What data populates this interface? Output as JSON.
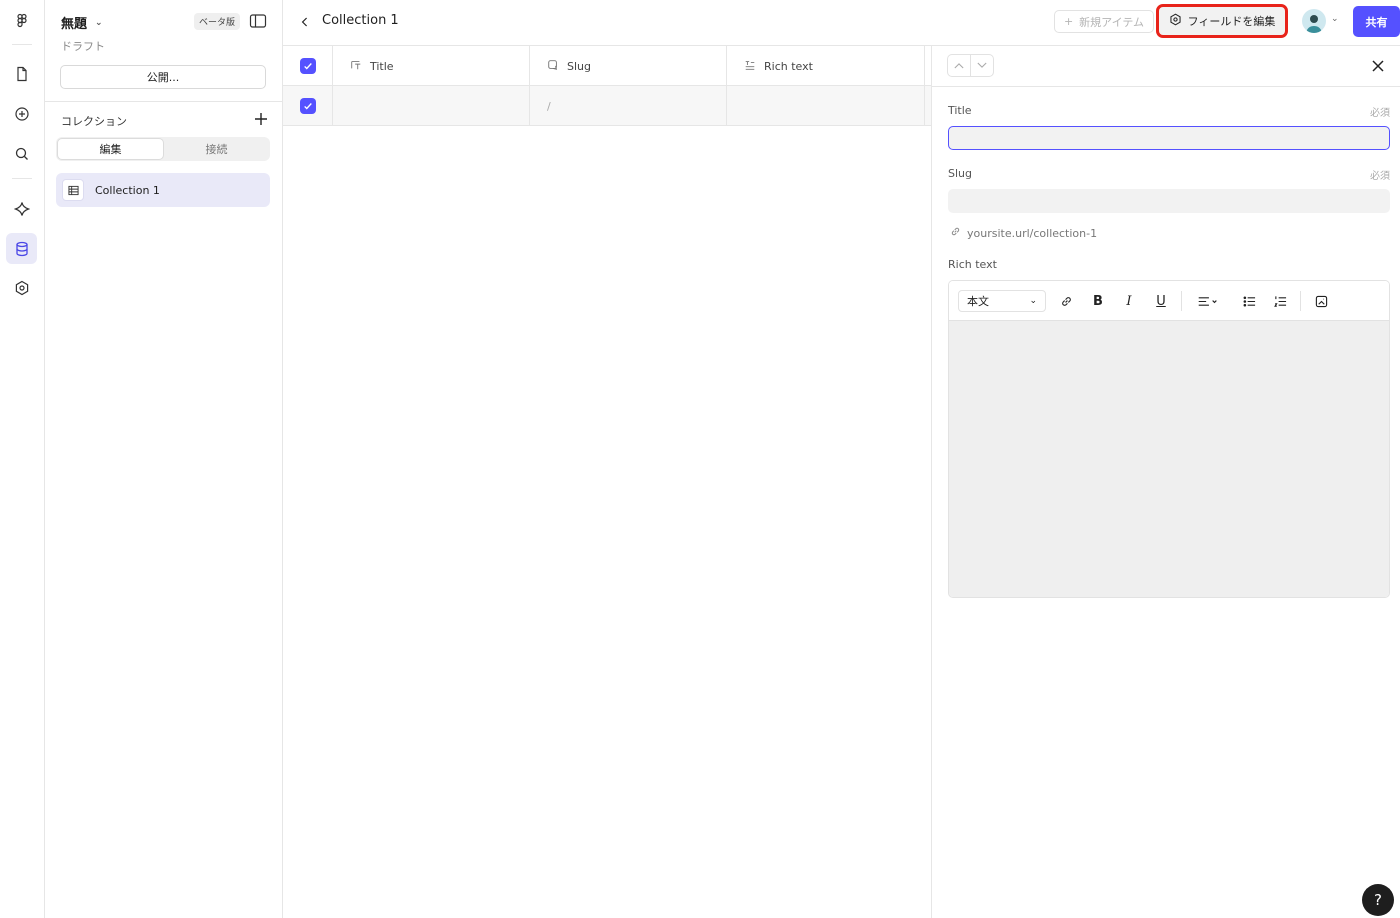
{
  "project": {
    "name": "無題",
    "beta_badge": "ベータ版",
    "status": "ドラフト",
    "publish_label": "公開..."
  },
  "collections": {
    "heading": "コレクション",
    "tabs": [
      "編集",
      "接続"
    ],
    "items": [
      {
        "label": "Collection 1"
      }
    ]
  },
  "header": {
    "title": "Collection 1",
    "new_item_label": "新規アイテム",
    "edit_fields_label": "フィールドを編集",
    "share_label": "共有"
  },
  "table": {
    "columns": [
      {
        "label": "Title",
        "icon": "title-field-icon"
      },
      {
        "label": "Slug",
        "icon": "slug-field-icon"
      },
      {
        "label": "Rich text",
        "icon": "rich-text-field-icon"
      }
    ],
    "rows": [
      {
        "title": "",
        "slug": "/",
        "rich_text": ""
      }
    ]
  },
  "editor": {
    "fields": [
      {
        "label": "Title",
        "required_label": "必須",
        "value": ""
      },
      {
        "label": "Slug",
        "required_label": "必須",
        "value": ""
      },
      {
        "label": "Rich text"
      }
    ],
    "slug_url": "yoursite.url/collection-1",
    "format_select": "本文"
  },
  "help_label": "?",
  "colors": {
    "accent": "#5551ff",
    "highlight_border": "#e8231a",
    "selected_bg": "#e9e9f8"
  }
}
